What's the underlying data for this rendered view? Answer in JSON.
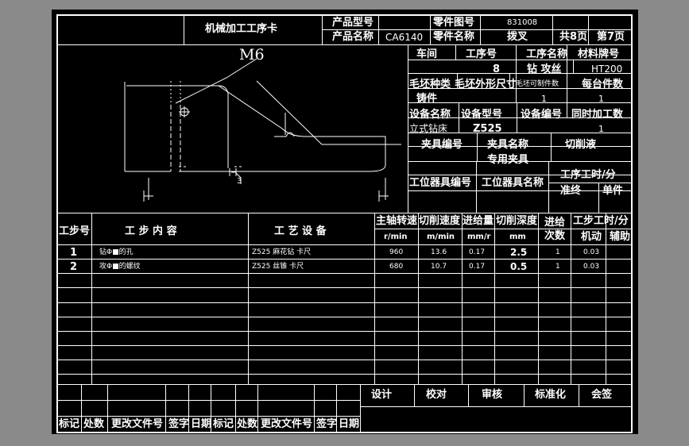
{
  "header": {
    "card_title": "机械加工工序卡",
    "product_model_label": "产品型号",
    "part_drawing_no_label": "零件图号",
    "part_drawing_no": "831008",
    "product_name_label": "产品名称",
    "product_name": "CA6140",
    "part_name_label": "零件名称",
    "part_name": "拨叉",
    "total_pages": "共8页",
    "page_no": "第7页"
  },
  "drawing": {
    "thread_label": "M6",
    "dim_3": "3"
  },
  "info": {
    "workshop_label": "车间",
    "op_no_label": "工序号",
    "op_no": "8",
    "op_name_label": "工序名称",
    "op_name": "钻  攻丝",
    "material_label": "材料牌号",
    "material": "HT200",
    "blank_type_label": "毛坯种类",
    "blank_size_label": "毛坯外形尺寸",
    "blank_parts_label": "毛坯可制件数",
    "parts_per_unit_label": "每台件数",
    "blank_type": "铸件",
    "blank_parts": "1",
    "parts_per_unit": "1",
    "equip_name_label": "设备名称",
    "equip_model_label": "设备型号",
    "equip_no_label": "设备编号",
    "simul_label": "同时加工数",
    "equip_name": "立式钻床",
    "equip_model": "Z525",
    "simul": "1",
    "fixture_no_label": "夹具编号",
    "fixture_name_label": "夹具名称",
    "coolant_label": "切削液",
    "fixture_name": "专用夹具",
    "station_tool_no_label": "工位器具编号",
    "station_tool_name_label": "工位器具名称",
    "op_time_label": "工序工时/分",
    "prep_label": "准终",
    "unit_label": "单件"
  },
  "steps_header": {
    "step_no": "工步号",
    "content": "工  步  内  容",
    "equipment": "工  艺  设  备",
    "spindle_speed": "主轴转速",
    "cut_speed": "切削速度",
    "feed": "进给量",
    "depth": "切削深度",
    "passes": "进给次数",
    "step_time": "工步工时/分",
    "u_speed": "r/min",
    "u_cut": "m/min",
    "u_feed": "mm/r",
    "u_depth": "mm",
    "machine": "机动",
    "aux": "辅助"
  },
  "steps": [
    {
      "no": "1",
      "content": "钻Φ■的孔",
      "equip": "Z525  麻花钻  卡尺",
      "speed": "960",
      "cut": "13.6",
      "feed": "0.17",
      "depth": "2.5",
      "passes": "1",
      "machine": "0.03"
    },
    {
      "no": "2",
      "content": "攻Φ■的螺纹",
      "equip": "Z525  丝锥  卡尺",
      "speed": "680",
      "cut": "10.7",
      "feed": "0.17",
      "depth": "0.5",
      "passes": "1",
      "machine": "0.03"
    }
  ],
  "footer": {
    "design": "设计",
    "proof": "校对",
    "review": "审核",
    "standard": "标准化",
    "sign": "会签",
    "mark": "标记",
    "count": "处数",
    "change_doc": "更改文件号",
    "signature": "签字",
    "date": "日期"
  }
}
